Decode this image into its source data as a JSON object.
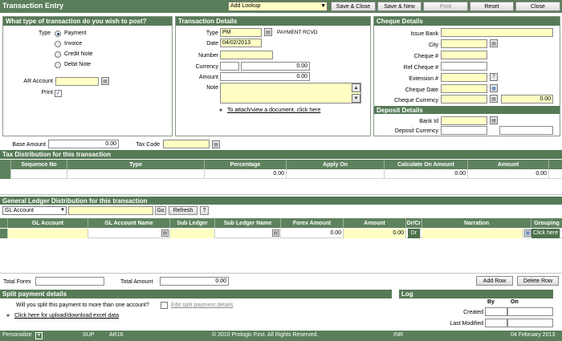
{
  "header": {
    "title": "Transaction Entry",
    "lookup_value": "Add Lookup",
    "buttons": [
      "Save & Close",
      "Save & New",
      "Print",
      "Reset",
      "Close"
    ]
  },
  "txn_type": {
    "heading": "What type of transaction do you wish to post?",
    "type_label": "Type",
    "options": [
      "Payment",
      "Invoice",
      "Credit Note",
      "Debit Note"
    ],
    "selected": "Payment",
    "ar_account_label": "AR Account",
    "print_label": "Print",
    "print_checked": "✓"
  },
  "txn_details": {
    "heading": "Transaction Details",
    "type_label": "Type",
    "type_value": "PM",
    "type_desc": "PAYMENT RCVD",
    "date_label": "Date",
    "date_value": "04/02/2013",
    "number_label": "Number",
    "currency_label": "Currency",
    "currency_value": "0.00",
    "amount_label": "Amount",
    "amount_value": "0.00",
    "note_label": "Note",
    "attach_link": "To attach/view a document, click here"
  },
  "cheque": {
    "heading": "Cheque Details",
    "issue_bank_label": "Issue Bank",
    "city_label": "City",
    "cheque_no_label": "Cheque #",
    "ref_cheque_label": "Ref Cheque #",
    "extension_label": "Extension #",
    "cheque_date_label": "Cheque Date",
    "cheque_currency_label": "Cheque Currency",
    "cheque_currency_value": "0.00",
    "help_glyph": "?"
  },
  "deposit": {
    "heading": "Deposit Details",
    "bank_id_label": "Bank Id",
    "deposit_currency_label": "Deposit Currency"
  },
  "base": {
    "base_amount_label": "Base Amount",
    "base_amount_value": "0.00",
    "tax_code_label": "Tax Code"
  },
  "tax": {
    "heading": "Tax Distribution for this transaction",
    "columns": [
      "Sequence No",
      "Type",
      "Percentage",
      "Apply On",
      "Calculate On Amount",
      "Amount"
    ],
    "row": [
      "",
      "",
      "0.00",
      "",
      "0.00",
      "0.00"
    ]
  },
  "gl": {
    "heading": "General Ledger Distribution for this transaction",
    "filter_value": "GL Account",
    "go_label": "Go",
    "refresh_label": "Refresh",
    "help_glyph": "?",
    "columns": [
      "GL Account",
      "GL Account Name",
      "Sub Ledger",
      "Sub Ledger Name",
      "Forex Amount",
      "Amount",
      "Dr/Cr",
      "Narration",
      "Grouping"
    ],
    "row": {
      "forex": "0.00",
      "amount": "0.00",
      "drcr": "Dr",
      "grouping": "Click here"
    }
  },
  "totals": {
    "total_forex_label": "Total Forex",
    "total_amount_label": "Total Amount",
    "total_amount_value": "0.00",
    "add_row": "Add Row",
    "delete_row": "Delete Row"
  },
  "split": {
    "heading": "Split payment details",
    "question": "Will you split this payment to more than one account?",
    "edit_link": "Edit split payment details",
    "excel_link": "Click here for upload/download excel data"
  },
  "log": {
    "heading": "Log",
    "by_label": "By",
    "on_label": "On",
    "created_label": "Created",
    "modified_label": "Last Modified"
  },
  "footer": {
    "personalize": "Personalize",
    "user": "SUP",
    "module": "AR16",
    "copyright": "© 2010 Prologic First. All Rights Reserved.",
    "currency": "INR",
    "date": "04 February 2013"
  },
  "colors": {
    "header_green": "#567a56",
    "field_yellow": "#ffffc4"
  }
}
